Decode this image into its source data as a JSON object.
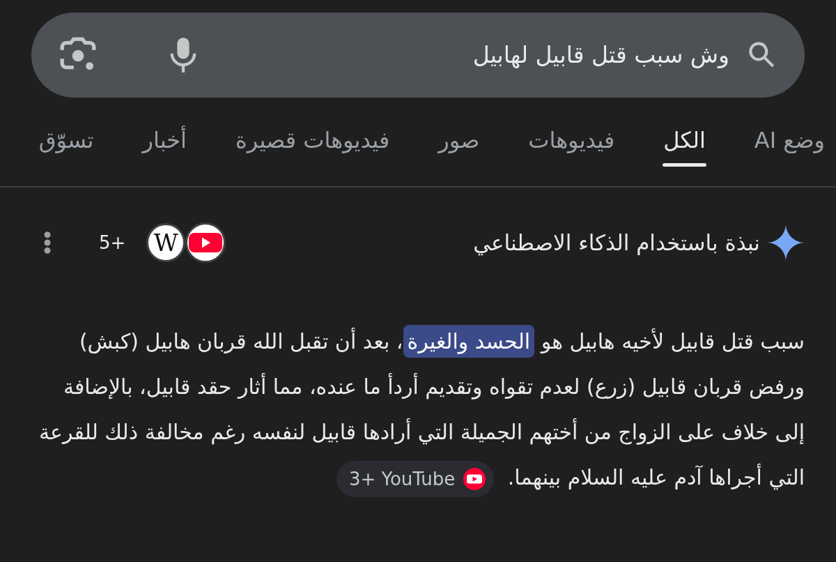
{
  "search": {
    "value": "وش سبب قتل قابيل لهابيل"
  },
  "tabs": [
    {
      "label": "وضع AI",
      "selected": false
    },
    {
      "label": "الكل",
      "selected": true
    },
    {
      "label": "فيديوهات",
      "selected": false
    },
    {
      "label": "صور",
      "selected": false
    },
    {
      "label": "فيديوهات قصيرة",
      "selected": false
    },
    {
      "label": "أخبار",
      "selected": false
    },
    {
      "label": "تسوّق",
      "selected": false
    }
  ],
  "ai_overview": {
    "title": "نبذة باستخدام الذكاء الاصطناعي",
    "sources": [
      {
        "kind": "video"
      },
      {
        "kind": "letter",
        "glyph": "W"
      }
    ],
    "sources_count": "5+",
    "paragraph": {
      "before": "سبب قتل قابيل لأخيه هابيل هو",
      "highlight": "الحسد والغيرة",
      "after": "، بعد أن تقبل الله قربان هابيل (كبش) ورفض قربان قابيل (زرع) لعدم تقواه وتقديم أردأ ما عنده، مما أثار حقد قابيل، بالإضافة إلى خلاف على الزواج من أختهم الجميلة التي أرادها قابيل لنفسه رغم مخالفة ذلك للقرعة التي أجراها آدم عليه السلام بينهما."
    },
    "citation": {
      "label": "3+ YouTube"
    }
  }
}
